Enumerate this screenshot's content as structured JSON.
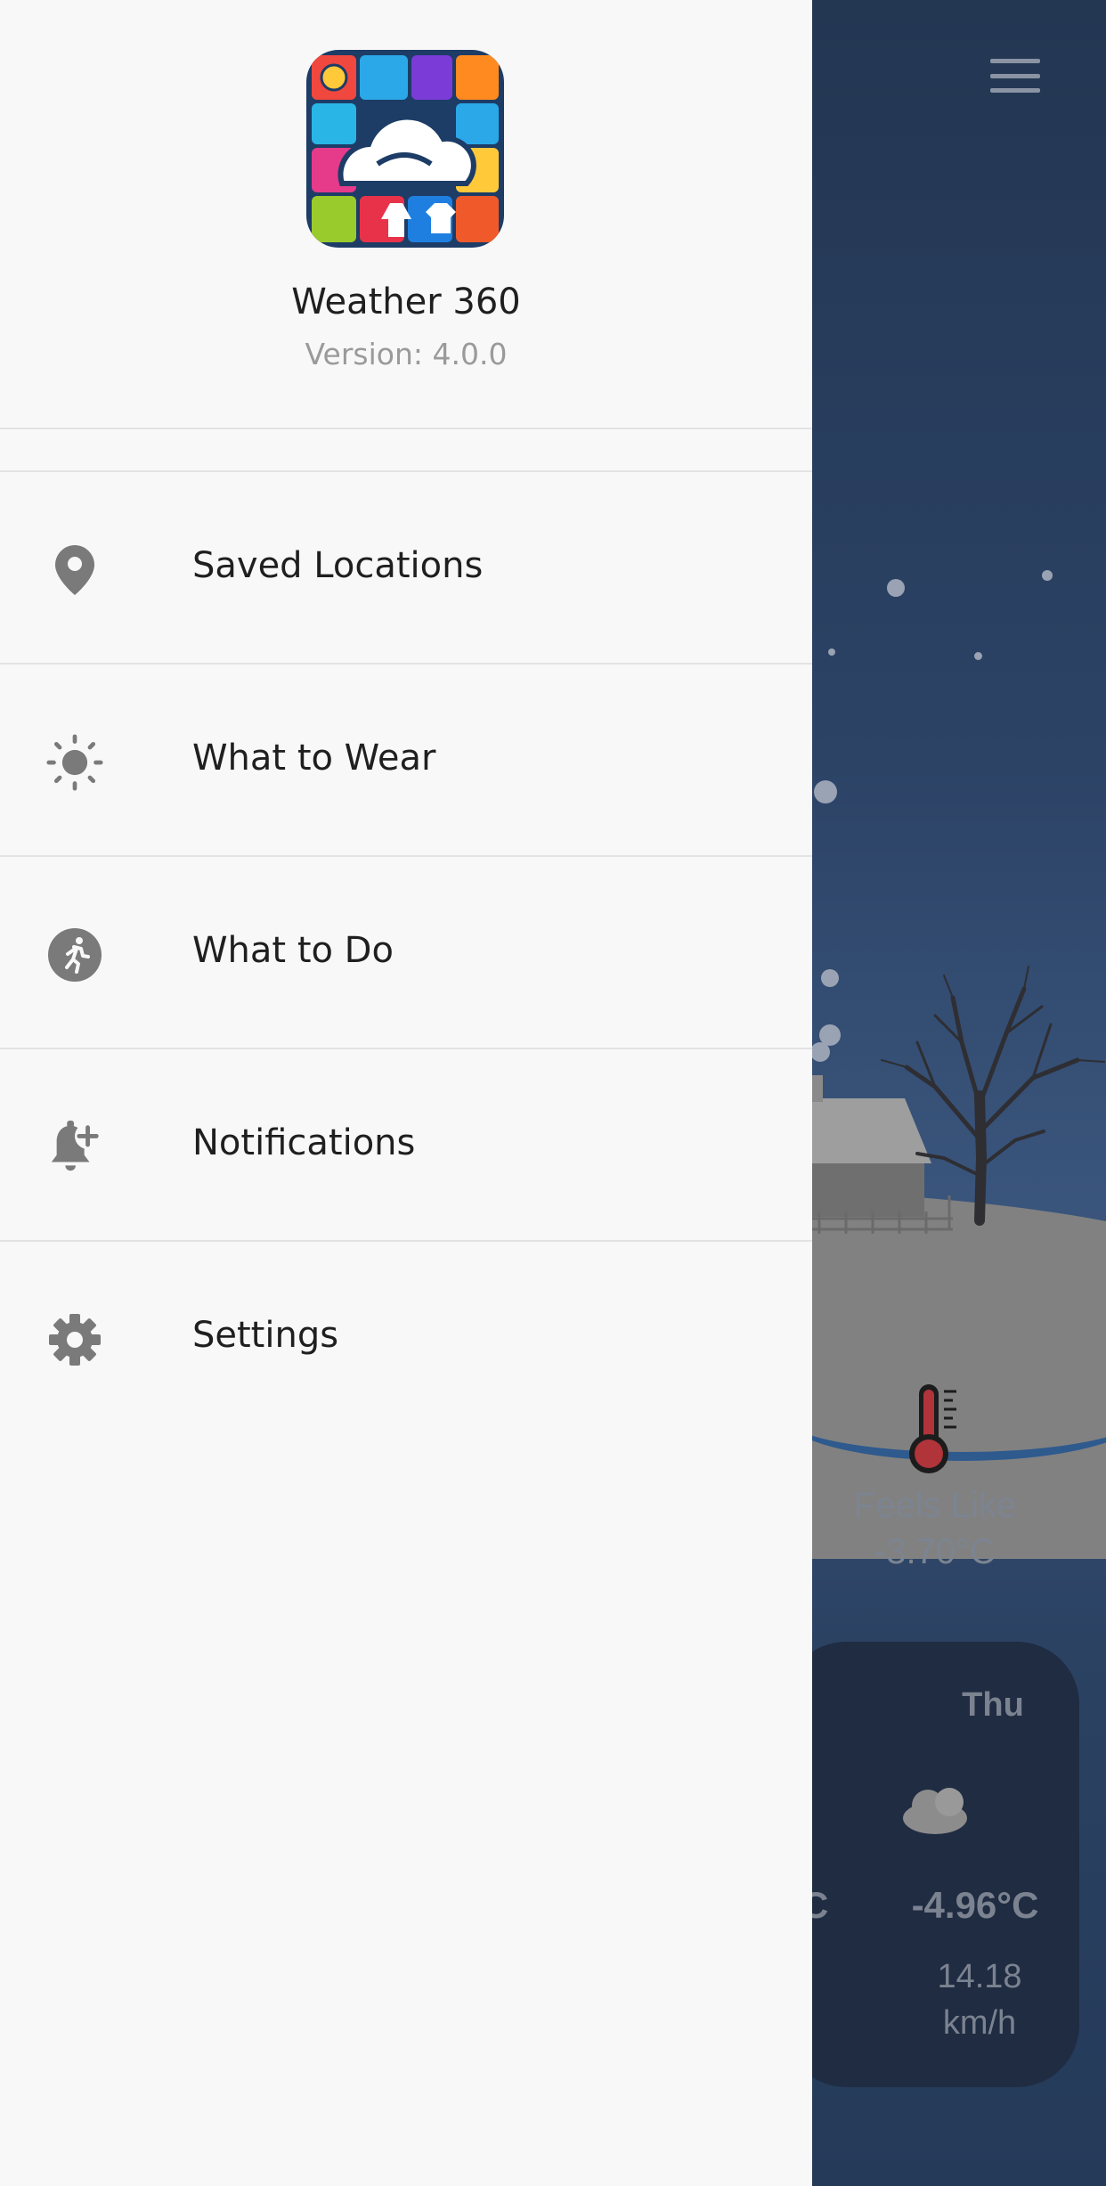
{
  "drawer": {
    "app_name": "Weather 360",
    "version": "Version: 4.0.0",
    "logo_icon": "weather-360-logo-icon",
    "items": [
      {
        "label": "Saved Locations",
        "icon": "location-pin-icon"
      },
      {
        "label": "What to Wear",
        "icon": "sun-icon"
      },
      {
        "label": "What to Do",
        "icon": "running-person-icon"
      },
      {
        "label": "Notifications",
        "icon": "bell-plus-icon"
      },
      {
        "label": "Settings",
        "icon": "gear-icon"
      }
    ]
  },
  "background": {
    "menu_icon": "hamburger-menu-icon",
    "feels_like_label": "Feels Like",
    "feels_like_value": "-3.70°C",
    "forecast": {
      "day": "Thu",
      "icon": "cloudy-night-icon",
      "partial_prev": "C",
      "temp": "-4.96°C",
      "wind_value": "14.18",
      "wind_unit": "km/h"
    }
  },
  "colors": {
    "drawer_bg": "#f8f8f8",
    "icon_gray": "#7a7a7a",
    "bg_blue": "#2c4366",
    "card_bg": "#1f2c42",
    "thermometer_red": "#b0343a"
  }
}
